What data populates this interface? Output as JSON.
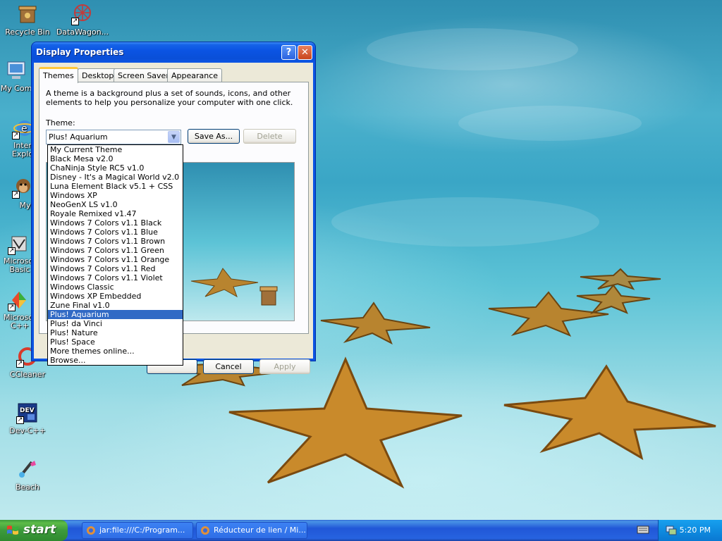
{
  "desktop": {
    "icons": [
      {
        "label": "Recycle Bin"
      },
      {
        "label": "DataWagon..."
      },
      {
        "label": "My Com"
      },
      {
        "label": "Inter Explo"
      },
      {
        "label": "Myp"
      },
      {
        "label": "Microsof Basic"
      },
      {
        "label": "Microsof C++"
      },
      {
        "label": "CCleaner"
      },
      {
        "label": "Dev-C++"
      },
      {
        "label": "Beach"
      }
    ]
  },
  "dialog": {
    "title": "Display Properties",
    "help_label": "?",
    "close_label": "✕",
    "tabs": [
      {
        "label": "Themes"
      },
      {
        "label": "Desktop"
      },
      {
        "label": "Screen Saver"
      },
      {
        "label": "Appearance"
      }
    ],
    "description": "A theme is a background plus a set of sounds, icons, and other elements to help you personalize your computer with one click.",
    "theme_label": "Theme:",
    "theme_value": "Plus! Aquarium",
    "save_as_label": "Save As...",
    "delete_label": "Delete",
    "ok_label": "",
    "cancel_label": "Cancel",
    "apply_label": "Apply",
    "dropdown_options": [
      "My Current Theme",
      "Black Mesa v2.0",
      "ChaNinja Style RC5 v1.0",
      "Disney - It's a Magical World v2.0",
      "Luna Element Black v5.1 + CSS",
      "Windows XP",
      "NeoGenX LS v1.0",
      "Royale Remixed v1.47",
      "Windows 7 Colors v1.1 Black",
      "Windows 7 Colors v1.1 Blue",
      "Windows 7 Colors v1.1 Brown",
      "Windows 7 Colors v1.1 Green",
      "Windows 7 Colors v1.1 Orange",
      "Windows 7 Colors v1.1 Red",
      "Windows 7 Colors v1.1 Violet",
      "Windows Classic",
      "Windows XP Embedded",
      "Zune Final v1.0",
      "Plus! Aquarium",
      "Plus! da Vinci",
      "Plus! Nature",
      "Plus! Space",
      "More themes online...",
      "Browse..."
    ],
    "selected_option": "Plus! Aquarium"
  },
  "taskbar": {
    "start_label": "start",
    "tasks": [
      {
        "label": "jar:file:///C:/Program..."
      },
      {
        "label": "Réducteur de lien / Mi..."
      }
    ],
    "clock": "5:20 PM"
  },
  "colors": {
    "selection": "#316ac5",
    "titlebar": "#0b54e3",
    "taskbar": "#2157d7",
    "start_button": "#3c9a3c"
  }
}
